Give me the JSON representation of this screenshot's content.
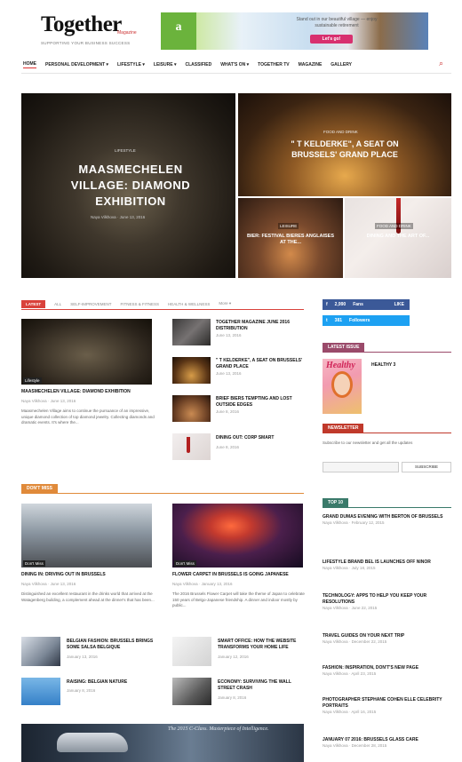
{
  "header": {
    "logo": "Together",
    "logo_sub": "Magazine",
    "tagline": "SUPPORTING YOUR BUSINESS SUCCESS",
    "search_icon": "search-icon"
  },
  "banner": {
    "brand": "a",
    "text": "Stand out in our beautiful village — enjoy sustainable retirement",
    "button": "Let's go!"
  },
  "nav": {
    "items": [
      "HOME",
      "PERSONAL DEVELOPMENT ▾",
      "LIFESTYLE ▾",
      "LEISURE ▾",
      "CLASSIFIED",
      "WHAT'S ON ▾",
      "TOGETHER TV",
      "MAGAZINE",
      "GALLERY"
    ]
  },
  "hero": {
    "big": {
      "category": "LIFESTYLE",
      "title": "MAASMECHELEN VILLAGE: DIAMOND EXHIBITION",
      "meta": "Naya Vilkhova · June 13, 2016"
    },
    "top_right": {
      "category": "FOOD AND DRINK",
      "title": "\" T KELDERKE\", A SEAT ON BRUSSELS' GRAND PLACE"
    },
    "bottom_left": {
      "category": "LEISURE",
      "title": "BIER: FESTIVAL BIERES ANGLAISES AT THE..."
    },
    "bottom_right": {
      "category": "FOOD AND DRINK",
      "title": "DINING AND THE ART OF..."
    }
  },
  "tabs": {
    "items": [
      "LATEST",
      "ALL",
      "SELF-IMPROVEMENT",
      "FITNESS & FITNESS",
      "HEALTH & WELLNESS",
      "More ▾"
    ]
  },
  "latest_main": {
    "badge": "Lifestyle",
    "title": "MAASMECHELEN VILLAGE: DIAMOND EXHIBITION",
    "meta": "Naya Vilkhova · June 13, 2016",
    "excerpt": "Maasmechelen Village aims to continue the pursuance of an impressive, unique diamond collection of top diamond jewelry. Collecting diamonds and dramatic events. It's where the..."
  },
  "latest_side": [
    {
      "title": "TOGETHER MAGAZINE JUNE 2016 DISTRIBUTION",
      "meta": "June 13, 2016"
    },
    {
      "title": "\" T KELDERKE\", A SEAT ON BRUSSELS' GRAND PLACE",
      "meta": "June 13, 2016"
    },
    {
      "title": "BRIEF BIERS TEMPTING AND LOST OUTSIDE EDGES",
      "meta": "June 8, 2016"
    },
    {
      "title": "DINING OUT: CORP SMART",
      "meta": "June 8, 2016"
    }
  ],
  "dont_miss": {
    "label": "DON'T MISS",
    "cards": [
      {
        "badge": "Don't Miss",
        "title": "DINING IN: DRIVING OUT IN BRUSSELS",
        "meta": "Naya Vilkhova · June 13, 2016",
        "excerpt": "Distinguished an excellent restaurant in the drinks world that arrived at the Watagenberg building, a complement ahead at the dinner's that has been..."
      },
      {
        "badge": "Don't Miss",
        "title": "FLOWER CARPET IN BRUSSELS IS GOING JAPANESE",
        "meta": "Naya Vilkhova · January 13, 2016",
        "excerpt": "The 2016 Brussels Flower Carpet will take the theme of Japan to celebrate 150 years of Belgo-Japanese friendship. A dinner and indoor mostly by public..."
      }
    ],
    "small": [
      {
        "title": "BELGIAN FASHION: BRUSSELS BRINGS SOME SALSA BELGIQUE",
        "meta": "January 13, 2016"
      },
      {
        "title": "SMART OFFICE: HOW THE WEBSITE TRANSFORMS YOUR HOME LIFE",
        "meta": "January 12, 2016"
      },
      {
        "title": "RAISING: BELGIAN NATURE",
        "meta": "January 8, 2016"
      },
      {
        "title": "ECONOMY: SURVIVING THE WALL STREET CRASH",
        "meta": "January 8, 2016"
      }
    ]
  },
  "sidebar": {
    "facebook": {
      "icon": "facebook-icon",
      "count": "2,990",
      "word": "Fans",
      "action": "LIKE"
    },
    "twitter": {
      "icon": "twitter-icon",
      "count": "381",
      "word": "Followers"
    },
    "latest_issue": {
      "label": "LATEST ISSUE",
      "magazine_title": "Healthy",
      "issue": "HEALTHY 3"
    },
    "newsletter": {
      "label": "NEWSLETTER",
      "text": "Subscribe to our newsletter and get all the updates",
      "placeholder": "",
      "button": "SUBSCRIBE"
    },
    "top10": {
      "label": "TOP 10",
      "items": [
        {
          "title": "GRAND DUMAS EVENING WITH BERTON OF BRUSSELS",
          "meta": "Naya Vilkhova · February 12, 2015"
        },
        {
          "title": "LIFESTYLE BRAND BEL IS LAUNCHES OFF NINOR",
          "meta": "Naya Vilkhova · July 18, 2015"
        },
        {
          "title": "TECHNOLOGY: APPS TO HELP YOU KEEP YOUR RESOLUTIONS",
          "meta": "Naya Vilkhova · June 22, 2015"
        },
        {
          "title": "TRAVEL GUIDES ON YOUR NEXT TRIP",
          "meta": "Naya Vilkhova · December 22, 2015"
        },
        {
          "title": "FASHION: INSPIRATION, DON'T'S NEW PAGE",
          "meta": "Naya Vilkhova · April 23, 2015"
        },
        {
          "title": "PHOTOGRAPHER STEPHANE COHEN ELLE CELEBRITY PORTRAITS",
          "meta": "Naya Vilkhova · April 16, 2015"
        },
        {
          "title": "JANUARY 07 2016: BRUSSELS GLASS CARE",
          "meta": "Naya Vilkhova · December 28, 2015"
        }
      ]
    }
  },
  "bottom_banner": {
    "text": "The 2015 C-Class. Masterpiece of Intelligence."
  },
  "colors": {
    "accent": "#d9423b",
    "dont_miss": "#e08a3a",
    "latest_issue": "#9a4a6a",
    "newsletter": "#c0392b",
    "top10": "#3a7a6a",
    "facebook": "#3b5998",
    "twitter": "#1da1f2"
  }
}
